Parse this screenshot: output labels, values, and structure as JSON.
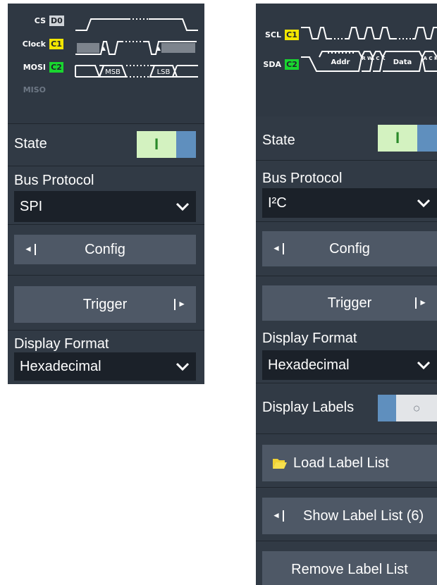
{
  "left_panel": {
    "diagram": {
      "signals": [
        {
          "name": "CS",
          "channel": "D0"
        },
        {
          "name": "Clock",
          "channel": "C1"
        },
        {
          "name": "MOSI",
          "channel": "C2"
        },
        {
          "name": "MISO",
          "channel": ""
        }
      ],
      "labels": {
        "msb": "MSB",
        "lsb": "LSB"
      }
    },
    "state": {
      "label": "State",
      "toggle_text": "I"
    },
    "bus_protocol": {
      "label": "Bus Protocol",
      "value": "SPI"
    },
    "config_button": "Config",
    "trigger_button": "Trigger",
    "display_format": {
      "label": "Display Format",
      "value": "Hexadecimal"
    }
  },
  "right_panel": {
    "diagram": {
      "signals": [
        {
          "name": "SCL",
          "channel": "C1"
        },
        {
          "name": "SDA",
          "channel": "C2"
        }
      ],
      "labels": {
        "addr": "Addr",
        "rw": "R W",
        "ack": "A C K",
        "data": "Data",
        "ack2": "A C K"
      }
    },
    "state": {
      "label": "State",
      "toggle_text": "I"
    },
    "bus_protocol": {
      "label": "Bus Protocol",
      "value": "I²C"
    },
    "config_button": "Config",
    "trigger_button": "Trigger",
    "display_format": {
      "label": "Display Format",
      "value": "Hexadecimal"
    },
    "display_labels": {
      "label": "Display Labels",
      "toggle_off_symbol": "○"
    },
    "load_label_list": "Load Label List",
    "show_label_list": "Show Label List (6)",
    "remove_label_list": "Remove Label List"
  },
  "colors": {
    "panel_bg": "#313a45",
    "button_bg": "#4e5866",
    "select_bg": "#1b2129",
    "toggle_on": "#d3f2c0",
    "toggle_knob": "#5f8fbe",
    "chip_d0": "#cfd3d8",
    "chip_c1": "#f2e600",
    "chip_c2": "#19d62f",
    "folder_icon": "#f2d233"
  }
}
